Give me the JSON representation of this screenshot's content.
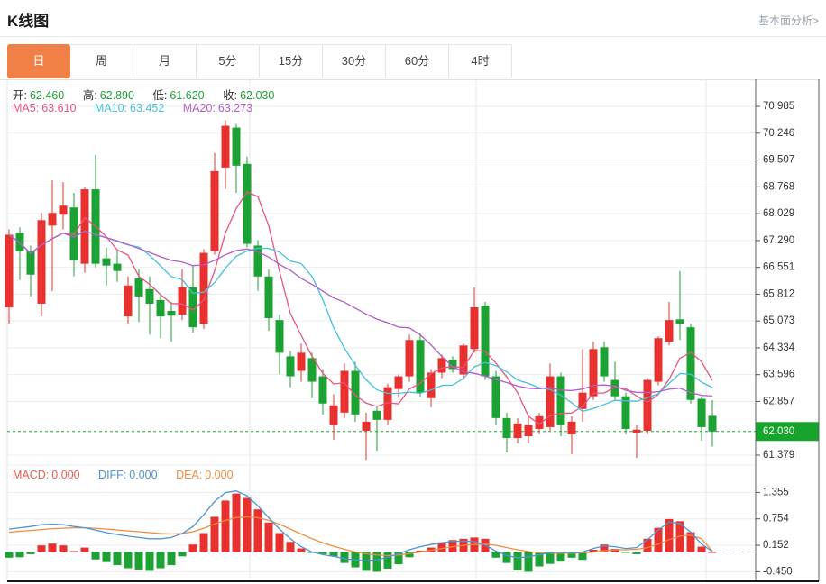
{
  "header": {
    "title": "K线图",
    "link": "基本面分析>"
  },
  "tabs": [
    {
      "id": "day",
      "label": "日",
      "active": true
    },
    {
      "id": "week",
      "label": "周",
      "active": false
    },
    {
      "id": "month",
      "label": "月",
      "active": false
    },
    {
      "id": "m5",
      "label": "5分",
      "active": false
    },
    {
      "id": "m15",
      "label": "15分",
      "active": false
    },
    {
      "id": "m30",
      "label": "30分",
      "active": false
    },
    {
      "id": "m60",
      "label": "60分",
      "active": false
    },
    {
      "id": "h4",
      "label": "4时",
      "active": false
    }
  ],
  "legend": {
    "ohlc": [
      {
        "label": "开:",
        "value": "62.460"
      },
      {
        "label": "高:",
        "value": "62.890"
      },
      {
        "label": "低:",
        "value": "61.620"
      },
      {
        "label": "收:",
        "value": "62.030"
      }
    ],
    "ma": [
      {
        "label": "MA5:",
        "value": "63.610",
        "color_key": "ma5"
      },
      {
        "label": "MA10:",
        "value": "63.452",
        "color_key": "ma10"
      },
      {
        "label": "MA20:",
        "value": "63.273",
        "color_key": "ma20"
      }
    ],
    "macd": [
      {
        "label": "MACD:",
        "value": "0.000",
        "color_key": "macd_label"
      },
      {
        "label": "DIFF:",
        "value": "0.000",
        "color_key": "diff"
      },
      {
        "label": "DEA:",
        "value": "0.000",
        "color_key": "dea"
      }
    ]
  },
  "colors": {
    "up": "#e8312e",
    "down": "#1ba233",
    "ma5": "#e8537f",
    "ma10": "#45c0dd",
    "ma20": "#b45bc8",
    "macd_label": "#e95c55",
    "diff": "#4f94d4",
    "dea": "#f08c3d",
    "value_green": "#21a038",
    "tag_bg": "#17a42c",
    "grid": "#ededed",
    "axis_line": "#5c5c5c",
    "tab_active": "#f08045"
  },
  "chart_data": {
    "type": "candlestick+macd",
    "title": "K线图 daily candlestick with MA5/MA10/MA20 and MACD",
    "price_axis_ticks": [
      "70.985",
      "70.246",
      "69.507",
      "68.768",
      "68.029",
      "67.290",
      "66.551",
      "65.812",
      "65.073",
      "64.334",
      "63.596",
      "62.857",
      "61.379"
    ],
    "current_price": 62.03,
    "current_price_label": "62.030",
    "macd_axis_ticks": [
      "1.355",
      "0.754",
      "0.152",
      "-0.450"
    ],
    "ma_periods": [
      5,
      10,
      20
    ],
    "grid_vertical_x": [
      277,
      528,
      783
    ],
    "candles_ohlc": [
      [
        65.45,
        67.6,
        65.0,
        67.45
      ],
      [
        67.5,
        67.65,
        66.2,
        67.0
      ],
      [
        67.0,
        67.15,
        65.75,
        66.35
      ],
      [
        65.55,
        68.05,
        65.2,
        67.85
      ],
      [
        67.7,
        68.95,
        65.9,
        68.05
      ],
      [
        68.0,
        68.9,
        67.6,
        68.25
      ],
      [
        68.2,
        68.6,
        66.3,
        66.75
      ],
      [
        66.65,
        68.75,
        66.4,
        68.7
      ],
      [
        68.7,
        69.65,
        66.55,
        66.65
      ],
      [
        66.8,
        67.1,
        66.05,
        66.6
      ],
      [
        66.65,
        67.0,
        66.15,
        66.45
      ],
      [
        65.2,
        66.3,
        65.0,
        66.05
      ],
      [
        66.25,
        66.5,
        65.05,
        65.75
      ],
      [
        65.95,
        66.3,
        64.7,
        65.55
      ],
      [
        65.65,
        65.8,
        64.6,
        65.2
      ],
      [
        65.35,
        65.6,
        64.5,
        65.22
      ],
      [
        65.25,
        66.5,
        65.1,
        66.0
      ],
      [
        66.0,
        66.6,
        64.75,
        64.9
      ],
      [
        65.0,
        67.05,
        64.85,
        66.95
      ],
      [
        67.0,
        69.7,
        66.9,
        69.2
      ],
      [
        69.3,
        70.6,
        68.7,
        70.45
      ],
      [
        70.4,
        70.5,
        68.6,
        69.35
      ],
      [
        69.4,
        69.6,
        67.1,
        67.2
      ],
      [
        67.15,
        67.3,
        65.9,
        66.3
      ],
      [
        66.3,
        66.5,
        64.8,
        65.15
      ],
      [
        65.1,
        65.25,
        63.6,
        64.2
      ],
      [
        64.1,
        64.25,
        63.25,
        63.55
      ],
      [
        63.7,
        64.45,
        63.4,
        64.2
      ],
      [
        64.05,
        64.2,
        62.95,
        63.4
      ],
      [
        63.55,
        63.75,
        62.5,
        62.8
      ],
      [
        62.2,
        63.05,
        61.8,
        62.75
      ],
      [
        62.55,
        63.9,
        62.4,
        63.7
      ],
      [
        63.7,
        63.95,
        62.3,
        62.5
      ],
      [
        62.05,
        62.55,
        61.25,
        62.3
      ],
      [
        62.6,
        62.75,
        61.5,
        62.35
      ],
      [
        62.35,
        63.35,
        62.2,
        63.25
      ],
      [
        63.2,
        63.6,
        62.95,
        63.55
      ],
      [
        63.55,
        64.7,
        63.4,
        64.55
      ],
      [
        64.55,
        64.75,
        63.0,
        63.1
      ],
      [
        62.95,
        63.75,
        62.7,
        63.65
      ],
      [
        63.65,
        64.15,
        63.5,
        64.05
      ],
      [
        64.0,
        64.1,
        63.65,
        63.75
      ],
      [
        63.6,
        64.45,
        63.45,
        64.4
      ],
      [
        64.3,
        66.0,
        64.2,
        65.45
      ],
      [
        65.5,
        65.6,
        63.45,
        63.55
      ],
      [
        63.55,
        63.7,
        62.2,
        62.4
      ],
      [
        62.4,
        62.55,
        61.45,
        61.85
      ],
      [
        61.85,
        62.4,
        61.7,
        62.25
      ],
      [
        61.9,
        62.45,
        61.7,
        62.2
      ],
      [
        62.1,
        62.55,
        61.95,
        62.45
      ],
      [
        62.15,
        63.9,
        62.05,
        63.55
      ],
      [
        63.55,
        63.65,
        61.9,
        62.2
      ],
      [
        61.95,
        62.45,
        61.4,
        62.3
      ],
      [
        62.65,
        64.3,
        62.3,
        63.1
      ],
      [
        63.0,
        64.5,
        62.9,
        64.3
      ],
      [
        64.35,
        64.5,
        63.4,
        63.55
      ],
      [
        63.45,
        63.95,
        62.9,
        63.0
      ],
      [
        63.0,
        63.1,
        61.95,
        62.1
      ],
      [
        62.0,
        62.2,
        61.3,
        62.08
      ],
      [
        62.05,
        63.5,
        61.95,
        63.45
      ],
      [
        63.4,
        64.65,
        63.3,
        64.6
      ],
      [
        64.5,
        65.6,
        64.4,
        65.1
      ],
      [
        65.12,
        66.45,
        64.55,
        65.0
      ],
      [
        64.9,
        65.0,
        62.8,
        62.9
      ],
      [
        62.93,
        63.0,
        61.78,
        62.15
      ],
      [
        62.46,
        62.89,
        61.62,
        62.03
      ]
    ],
    "macd_histogram": [
      -0.13,
      -0.12,
      -0.05,
      0.15,
      0.19,
      0.15,
      0.01,
      0.1,
      -0.17,
      -0.23,
      -0.3,
      -0.37,
      -0.4,
      -0.43,
      -0.37,
      -0.3,
      -0.1,
      0.17,
      0.43,
      0.8,
      1.17,
      1.33,
      1.23,
      0.97,
      0.67,
      0.43,
      0.23,
      0.08,
      -0.02,
      -0.05,
      -0.1,
      -0.25,
      -0.35,
      -0.43,
      -0.45,
      -0.38,
      -0.28,
      -0.12,
      0.03,
      0.1,
      0.22,
      0.27,
      0.3,
      0.33,
      0.3,
      -0.13,
      -0.25,
      -0.42,
      -0.45,
      -0.33,
      -0.27,
      -0.22,
      -0.13,
      -0.18,
      0.05,
      0.17,
      0.07,
      -0.02,
      -0.05,
      0.3,
      0.55,
      0.75,
      0.7,
      0.45,
      0.12,
      0.0
    ],
    "diff_line": [
      0.52,
      0.55,
      0.58,
      0.62,
      0.63,
      0.62,
      0.58,
      0.55,
      0.5,
      0.44,
      0.4,
      0.36,
      0.33,
      0.3,
      0.3,
      0.33,
      0.42,
      0.58,
      0.85,
      1.15,
      1.35,
      1.39,
      1.28,
      1.05,
      0.78,
      0.52,
      0.3,
      0.12,
      0.0,
      -0.06,
      -0.1,
      -0.15,
      -0.18,
      -0.2,
      -0.18,
      -0.12,
      -0.04,
      0.05,
      0.12,
      0.17,
      0.21,
      0.24,
      0.25,
      0.24,
      0.16,
      0.02,
      -0.08,
      -0.13,
      -0.11,
      -0.06,
      -0.02,
      0.0,
      -0.02,
      0.0,
      0.08,
      0.14,
      0.12,
      0.08,
      0.1,
      0.28,
      0.5,
      0.68,
      0.65,
      0.45,
      0.18,
      0.01
    ],
    "dea_line": [
      0.45,
      0.47,
      0.49,
      0.51,
      0.53,
      0.54,
      0.55,
      0.55,
      0.54,
      0.52,
      0.5,
      0.48,
      0.46,
      0.44,
      0.42,
      0.41,
      0.42,
      0.46,
      0.54,
      0.64,
      0.72,
      0.78,
      0.8,
      0.78,
      0.72,
      0.63,
      0.52,
      0.41,
      0.3,
      0.21,
      0.13,
      0.06,
      0.0,
      -0.04,
      -0.07,
      -0.08,
      -0.07,
      -0.04,
      0.0,
      0.04,
      0.08,
      0.12,
      0.15,
      0.17,
      0.18,
      0.15,
      0.1,
      0.05,
      0.01,
      -0.02,
      -0.03,
      -0.03,
      -0.03,
      -0.02,
      0.0,
      0.03,
      0.05,
      0.05,
      0.06,
      0.1,
      0.18,
      0.28,
      0.36,
      0.38,
      0.3,
      0.02
    ]
  }
}
